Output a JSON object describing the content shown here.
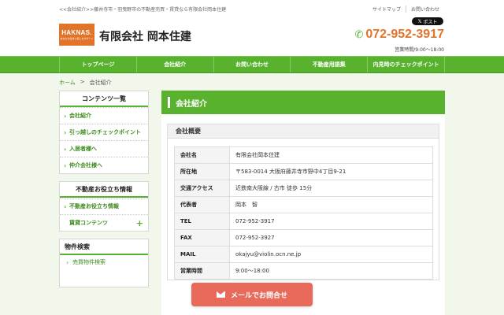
{
  "header": {
    "tagline": "<<会社紹介>>藤井寺市・羽曳野市の不動産売買・賃貸なら有限会社岡本住建",
    "top_links": [
      "サイトマップ",
      "お問い合わせ"
    ],
    "post_label": "ポスト",
    "logo_text": "HAKNAS.",
    "logo_sub": "あなたの住まい探しをサポート",
    "site_name": "有限会社 岡本住建",
    "phone": "072-952-3917",
    "hours": "営業時間/9:00～18:00"
  },
  "nav": {
    "items": [
      "トップページ",
      "会社紹介",
      "お問い合わせ",
      "不動産用語集",
      "内見時のチェックポイント"
    ]
  },
  "breadcrumb": {
    "home": "ホーム",
    "separator": ">",
    "current": "会社紹介"
  },
  "sidebar": {
    "contents_title": "コンテンツ一覧",
    "contents_items": [
      "会社紹介",
      "引っ越しのチェックポイント",
      "入居者様へ",
      "仲介会社様へ"
    ],
    "useful_title": "不動産お役立ち情報",
    "useful_items": [
      "不動産お役立ち情報",
      "賃貸コンテンツ"
    ],
    "property_title": "物件検索",
    "property_items": [
      "売買物件検索"
    ]
  },
  "main": {
    "page_title": "会社紹介",
    "section_title": "会社概要",
    "rows": [
      {
        "key": "会社名",
        "value": "有限会社岡本住建"
      },
      {
        "key": "所在地",
        "value": "〒583-0014 大阪府藤井寺市野中4丁目9-21"
      },
      {
        "key": "交通アクセス",
        "value": "近鉄南大阪線 / 古市 徒歩 15分"
      },
      {
        "key": "代表者",
        "value": "岡本　智"
      },
      {
        "key": "TEL",
        "value": "072-952-3917"
      },
      {
        "key": "FAX",
        "value": "072-952-3927"
      },
      {
        "key": "MAIL",
        "value": "okajyu@violin.ocn.ne.jp"
      },
      {
        "key": "営業時間",
        "value": "9:00～18:00"
      }
    ]
  },
  "floating": {
    "mail_label": "メールでお問合せ"
  },
  "colors": {
    "accent_green": "#58b22e",
    "accent_orange": "#e2742a",
    "mail_button": "#e86a5a"
  }
}
